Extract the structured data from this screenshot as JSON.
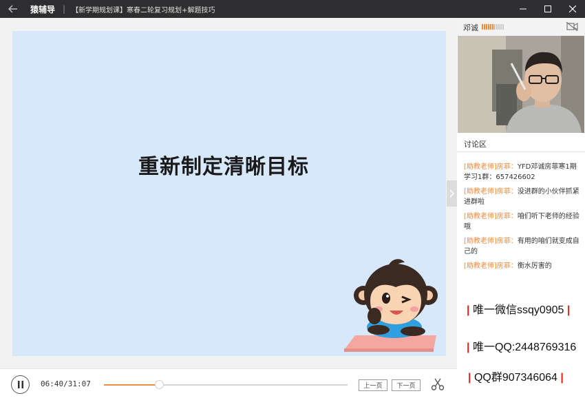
{
  "titlebar": {
    "back_icon": "arrow-left-icon",
    "app_name": "猿辅导",
    "separator": "|",
    "course_title": "【新学期规划课】寒春二轮复习规划+解题技巧"
  },
  "slide": {
    "heading": "重新制定清晰目标"
  },
  "player": {
    "time": "06:40/31:07",
    "progress": 0.225,
    "prev_page": "上一页",
    "next_page": "下一页"
  },
  "sidebar": {
    "teacher_name": "邓诚",
    "discussion_title": "讨论区",
    "chat": [
      {
        "sender": "[助教老师]房菲：",
        "text": "YFD邓诚房菲寒1期学习1群：657426602"
      },
      {
        "sender": "[助教老师]房菲：",
        "text": "没进群的小伙伴抓紧进群啦"
      },
      {
        "sender": "[助教老师]房菲：",
        "text": "咱们听下老师的经验哦"
      },
      {
        "sender": "[助教老师]房菲：",
        "text": "有用的咱们就变成自己的"
      },
      {
        "sender": "[助教老师]房菲：",
        "text": "衡水厉害的"
      }
    ]
  },
  "overlay": {
    "bar": "|",
    "wechat": "唯一微信ssqy0905",
    "qq": "唯一QQ:2448769316",
    "qq_group": "QQ群907346064"
  },
  "colors": {
    "accent": "#f08a3c",
    "titlebar": "#2e2e30",
    "slide_bg": "#d7e8fb",
    "overlay_bar": "#e0241b"
  }
}
